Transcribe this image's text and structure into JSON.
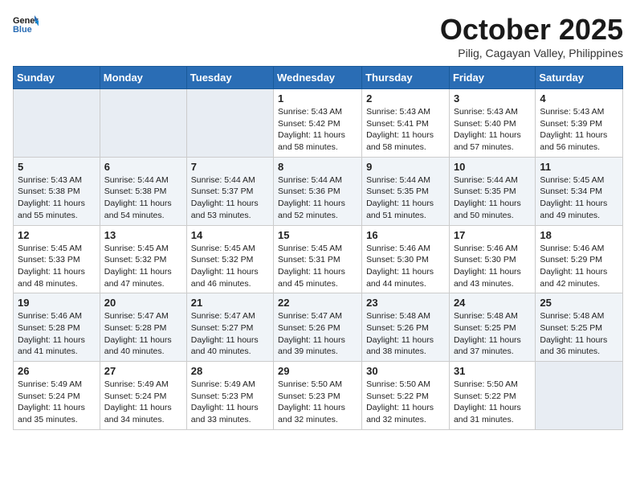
{
  "header": {
    "logo_line1": "General",
    "logo_line2": "Blue",
    "month": "October 2025",
    "location": "Pilig, Cagayan Valley, Philippines"
  },
  "weekdays": [
    "Sunday",
    "Monday",
    "Tuesday",
    "Wednesday",
    "Thursday",
    "Friday",
    "Saturday"
  ],
  "weeks": [
    [
      {
        "day": "",
        "sunrise": "",
        "sunset": "",
        "daylight": ""
      },
      {
        "day": "",
        "sunrise": "",
        "sunset": "",
        "daylight": ""
      },
      {
        "day": "",
        "sunrise": "",
        "sunset": "",
        "daylight": ""
      },
      {
        "day": "1",
        "sunrise": "Sunrise: 5:43 AM",
        "sunset": "Sunset: 5:42 PM",
        "daylight": "Daylight: 11 hours and 58 minutes."
      },
      {
        "day": "2",
        "sunrise": "Sunrise: 5:43 AM",
        "sunset": "Sunset: 5:41 PM",
        "daylight": "Daylight: 11 hours and 58 minutes."
      },
      {
        "day": "3",
        "sunrise": "Sunrise: 5:43 AM",
        "sunset": "Sunset: 5:40 PM",
        "daylight": "Daylight: 11 hours and 57 minutes."
      },
      {
        "day": "4",
        "sunrise": "Sunrise: 5:43 AM",
        "sunset": "Sunset: 5:39 PM",
        "daylight": "Daylight: 11 hours and 56 minutes."
      }
    ],
    [
      {
        "day": "5",
        "sunrise": "Sunrise: 5:43 AM",
        "sunset": "Sunset: 5:38 PM",
        "daylight": "Daylight: 11 hours and 55 minutes."
      },
      {
        "day": "6",
        "sunrise": "Sunrise: 5:44 AM",
        "sunset": "Sunset: 5:38 PM",
        "daylight": "Daylight: 11 hours and 54 minutes."
      },
      {
        "day": "7",
        "sunrise": "Sunrise: 5:44 AM",
        "sunset": "Sunset: 5:37 PM",
        "daylight": "Daylight: 11 hours and 53 minutes."
      },
      {
        "day": "8",
        "sunrise": "Sunrise: 5:44 AM",
        "sunset": "Sunset: 5:36 PM",
        "daylight": "Daylight: 11 hours and 52 minutes."
      },
      {
        "day": "9",
        "sunrise": "Sunrise: 5:44 AM",
        "sunset": "Sunset: 5:35 PM",
        "daylight": "Daylight: 11 hours and 51 minutes."
      },
      {
        "day": "10",
        "sunrise": "Sunrise: 5:44 AM",
        "sunset": "Sunset: 5:35 PM",
        "daylight": "Daylight: 11 hours and 50 minutes."
      },
      {
        "day": "11",
        "sunrise": "Sunrise: 5:45 AM",
        "sunset": "Sunset: 5:34 PM",
        "daylight": "Daylight: 11 hours and 49 minutes."
      }
    ],
    [
      {
        "day": "12",
        "sunrise": "Sunrise: 5:45 AM",
        "sunset": "Sunset: 5:33 PM",
        "daylight": "Daylight: 11 hours and 48 minutes."
      },
      {
        "day": "13",
        "sunrise": "Sunrise: 5:45 AM",
        "sunset": "Sunset: 5:32 PM",
        "daylight": "Daylight: 11 hours and 47 minutes."
      },
      {
        "day": "14",
        "sunrise": "Sunrise: 5:45 AM",
        "sunset": "Sunset: 5:32 PM",
        "daylight": "Daylight: 11 hours and 46 minutes."
      },
      {
        "day": "15",
        "sunrise": "Sunrise: 5:45 AM",
        "sunset": "Sunset: 5:31 PM",
        "daylight": "Daylight: 11 hours and 45 minutes."
      },
      {
        "day": "16",
        "sunrise": "Sunrise: 5:46 AM",
        "sunset": "Sunset: 5:30 PM",
        "daylight": "Daylight: 11 hours and 44 minutes."
      },
      {
        "day": "17",
        "sunrise": "Sunrise: 5:46 AM",
        "sunset": "Sunset: 5:30 PM",
        "daylight": "Daylight: 11 hours and 43 minutes."
      },
      {
        "day": "18",
        "sunrise": "Sunrise: 5:46 AM",
        "sunset": "Sunset: 5:29 PM",
        "daylight": "Daylight: 11 hours and 42 minutes."
      }
    ],
    [
      {
        "day": "19",
        "sunrise": "Sunrise: 5:46 AM",
        "sunset": "Sunset: 5:28 PM",
        "daylight": "Daylight: 11 hours and 41 minutes."
      },
      {
        "day": "20",
        "sunrise": "Sunrise: 5:47 AM",
        "sunset": "Sunset: 5:28 PM",
        "daylight": "Daylight: 11 hours and 40 minutes."
      },
      {
        "day": "21",
        "sunrise": "Sunrise: 5:47 AM",
        "sunset": "Sunset: 5:27 PM",
        "daylight": "Daylight: 11 hours and 40 minutes."
      },
      {
        "day": "22",
        "sunrise": "Sunrise: 5:47 AM",
        "sunset": "Sunset: 5:26 PM",
        "daylight": "Daylight: 11 hours and 39 minutes."
      },
      {
        "day": "23",
        "sunrise": "Sunrise: 5:48 AM",
        "sunset": "Sunset: 5:26 PM",
        "daylight": "Daylight: 11 hours and 38 minutes."
      },
      {
        "day": "24",
        "sunrise": "Sunrise: 5:48 AM",
        "sunset": "Sunset: 5:25 PM",
        "daylight": "Daylight: 11 hours and 37 minutes."
      },
      {
        "day": "25",
        "sunrise": "Sunrise: 5:48 AM",
        "sunset": "Sunset: 5:25 PM",
        "daylight": "Daylight: 11 hours and 36 minutes."
      }
    ],
    [
      {
        "day": "26",
        "sunrise": "Sunrise: 5:49 AM",
        "sunset": "Sunset: 5:24 PM",
        "daylight": "Daylight: 11 hours and 35 minutes."
      },
      {
        "day": "27",
        "sunrise": "Sunrise: 5:49 AM",
        "sunset": "Sunset: 5:24 PM",
        "daylight": "Daylight: 11 hours and 34 minutes."
      },
      {
        "day": "28",
        "sunrise": "Sunrise: 5:49 AM",
        "sunset": "Sunset: 5:23 PM",
        "daylight": "Daylight: 11 hours and 33 minutes."
      },
      {
        "day": "29",
        "sunrise": "Sunrise: 5:50 AM",
        "sunset": "Sunset: 5:23 PM",
        "daylight": "Daylight: 11 hours and 32 minutes."
      },
      {
        "day": "30",
        "sunrise": "Sunrise: 5:50 AM",
        "sunset": "Sunset: 5:22 PM",
        "daylight": "Daylight: 11 hours and 32 minutes."
      },
      {
        "day": "31",
        "sunrise": "Sunrise: 5:50 AM",
        "sunset": "Sunset: 5:22 PM",
        "daylight": "Daylight: 11 hours and 31 minutes."
      },
      {
        "day": "",
        "sunrise": "",
        "sunset": "",
        "daylight": ""
      }
    ]
  ]
}
